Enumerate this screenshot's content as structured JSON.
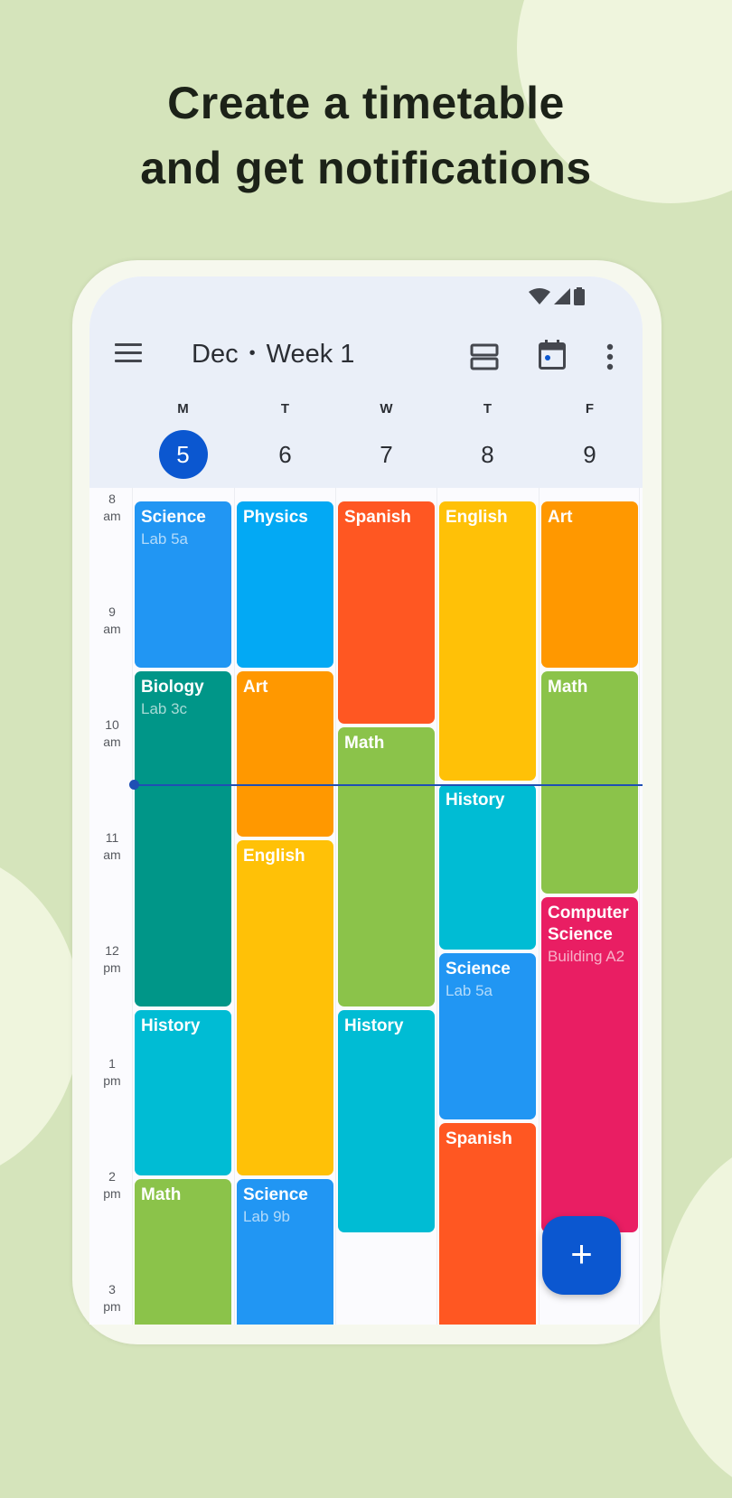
{
  "headline": [
    "Create a timetable",
    "and get notifications"
  ],
  "app": {
    "title_month": "Dec",
    "title_separator": "•",
    "title_week": "Week 1",
    "icons": {
      "menu": "menu-icon",
      "view": "view-agenda-icon",
      "today": "calendar-today-icon",
      "more": "more-vert-icon",
      "fab": "add-icon"
    },
    "fab_label": "+"
  },
  "status_bar": [
    "wifi-icon",
    "signal-icon",
    "battery-icon"
  ],
  "days": [
    {
      "letter": "M",
      "number": "5",
      "today": true
    },
    {
      "letter": "T",
      "number": "6",
      "today": false
    },
    {
      "letter": "W",
      "number": "7",
      "today": false
    },
    {
      "letter": "T",
      "number": "8",
      "today": false
    },
    {
      "letter": "F",
      "number": "9",
      "today": false
    }
  ],
  "time_labels": [
    {
      "hour": "8",
      "period": "am"
    },
    {
      "hour": "9",
      "period": "am"
    },
    {
      "hour": "10",
      "period": "am"
    },
    {
      "hour": "11",
      "period": "am"
    },
    {
      "hour": "12",
      "period": "pm"
    },
    {
      "hour": "1",
      "period": "pm"
    },
    {
      "hour": "2",
      "period": "pm"
    },
    {
      "hour": "3",
      "period": "pm"
    }
  ],
  "current_time_hours": 10.5,
  "events": [
    {
      "day": 0,
      "start": 8.0,
      "end": 9.5,
      "name": "Science",
      "room": "Lab 5a",
      "color": "#2196f3"
    },
    {
      "day": 0,
      "start": 9.5,
      "end": 12.5,
      "name": "Biology",
      "room": "Lab 3c",
      "color": "#009688"
    },
    {
      "day": 0,
      "start": 12.5,
      "end": 14.0,
      "name": "History",
      "room": "",
      "color": "#00bcd4"
    },
    {
      "day": 0,
      "start": 14.0,
      "end": 15.5,
      "name": "Math",
      "room": "",
      "color": "#8bc34a"
    },
    {
      "day": 1,
      "start": 8.0,
      "end": 9.5,
      "name": "Physics",
      "room": "",
      "color": "#03a9f4"
    },
    {
      "day": 1,
      "start": 9.5,
      "end": 11.0,
      "name": "Art",
      "room": "",
      "color": "#ff9800"
    },
    {
      "day": 1,
      "start": 11.0,
      "end": 14.0,
      "name": "English",
      "room": "",
      "color": "#ffc107"
    },
    {
      "day": 1,
      "start": 14.0,
      "end": 15.5,
      "name": "Science",
      "room": "Lab 9b",
      "color": "#2196f3"
    },
    {
      "day": 2,
      "start": 8.0,
      "end": 10.0,
      "name": "Spanish",
      "room": "",
      "color": "#ff5722"
    },
    {
      "day": 2,
      "start": 10.0,
      "end": 12.5,
      "name": "Math",
      "room": "",
      "color": "#8bc34a"
    },
    {
      "day": 2,
      "start": 12.5,
      "end": 14.5,
      "name": "History",
      "room": "",
      "color": "#00bcd4"
    },
    {
      "day": 3,
      "start": 8.0,
      "end": 10.5,
      "name": "English",
      "room": "",
      "color": "#ffc107"
    },
    {
      "day": 3,
      "start": 10.5,
      "end": 12.0,
      "name": "History",
      "room": "",
      "color": "#00bcd4"
    },
    {
      "day": 3,
      "start": 12.0,
      "end": 13.5,
      "name": "Science",
      "room": "Lab 5a",
      "color": "#2196f3"
    },
    {
      "day": 3,
      "start": 13.5,
      "end": 15.5,
      "name": "Spanish",
      "room": "",
      "color": "#ff5722"
    },
    {
      "day": 4,
      "start": 8.0,
      "end": 9.5,
      "name": "Art",
      "room": "",
      "color": "#ff9800"
    },
    {
      "day": 4,
      "start": 9.5,
      "end": 11.5,
      "name": "Math",
      "room": "",
      "color": "#8bc34a"
    },
    {
      "day": 4,
      "start": 11.5,
      "end": 14.5,
      "name": "Computer Science",
      "room": "Building A2",
      "color": "#e91e63"
    }
  ]
}
